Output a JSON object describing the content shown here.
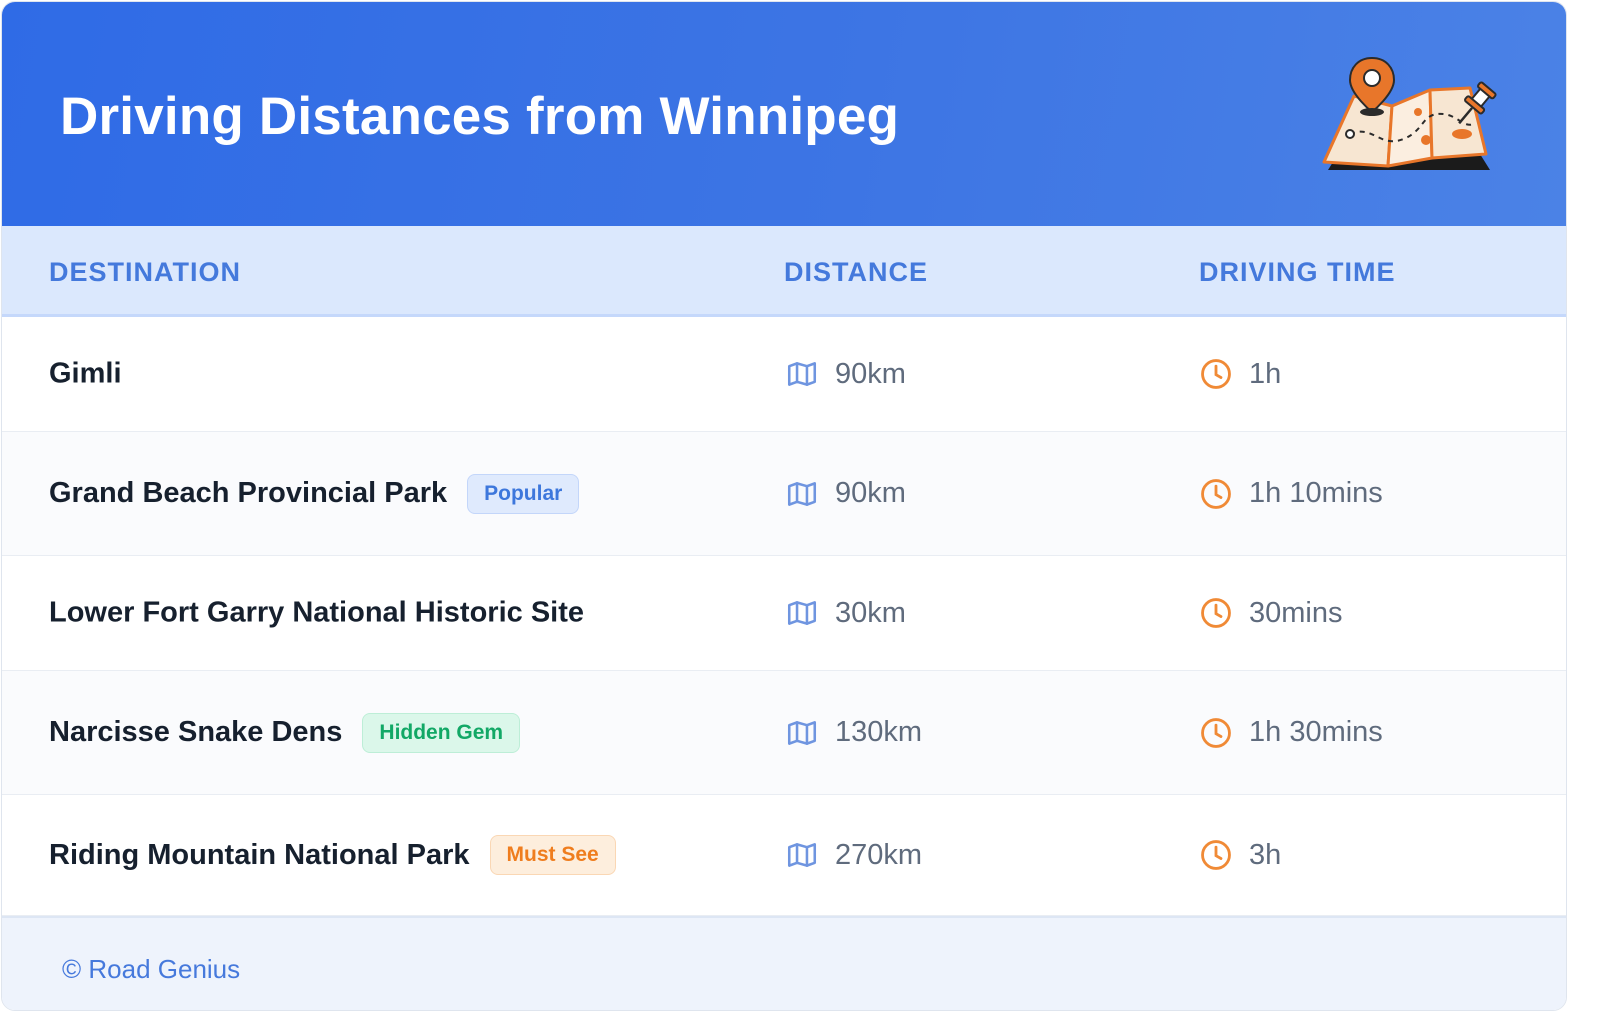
{
  "header": {
    "title": "Driving Distances from Winnipeg",
    "illustration": "map-with-pins-icon"
  },
  "table": {
    "columns": [
      "DESTINATION",
      "DISTANCE",
      "DRIVING TIME"
    ],
    "rows": [
      {
        "destination": "Gimli",
        "badge": "",
        "badge_color": "",
        "distance": "90km",
        "time": "1h"
      },
      {
        "destination": "Grand Beach Provincial Park",
        "badge": "Popular",
        "badge_color": "blue",
        "distance": "90km",
        "time": "1h 10mins"
      },
      {
        "destination": "Lower Fort Garry National Historic Site",
        "badge": "",
        "badge_color": "",
        "distance": "30km",
        "time": "30mins"
      },
      {
        "destination": "Narcisse Snake Dens",
        "badge": "Hidden Gem",
        "badge_color": "green",
        "distance": "130km",
        "time": "1h 30mins"
      },
      {
        "destination": "Riding Mountain National Park",
        "badge": "Must See",
        "badge_color": "orange",
        "distance": "270km",
        "time": "3h"
      }
    ]
  },
  "footer": {
    "credit": "© Road Genius"
  },
  "colors": {
    "header_gradient_start": "#2f6be6",
    "header_gradient_end": "#4b82e6",
    "column_header_text": "#4479dc",
    "distance_icon": "#6f95e0",
    "time_icon": "#f08a36"
  }
}
